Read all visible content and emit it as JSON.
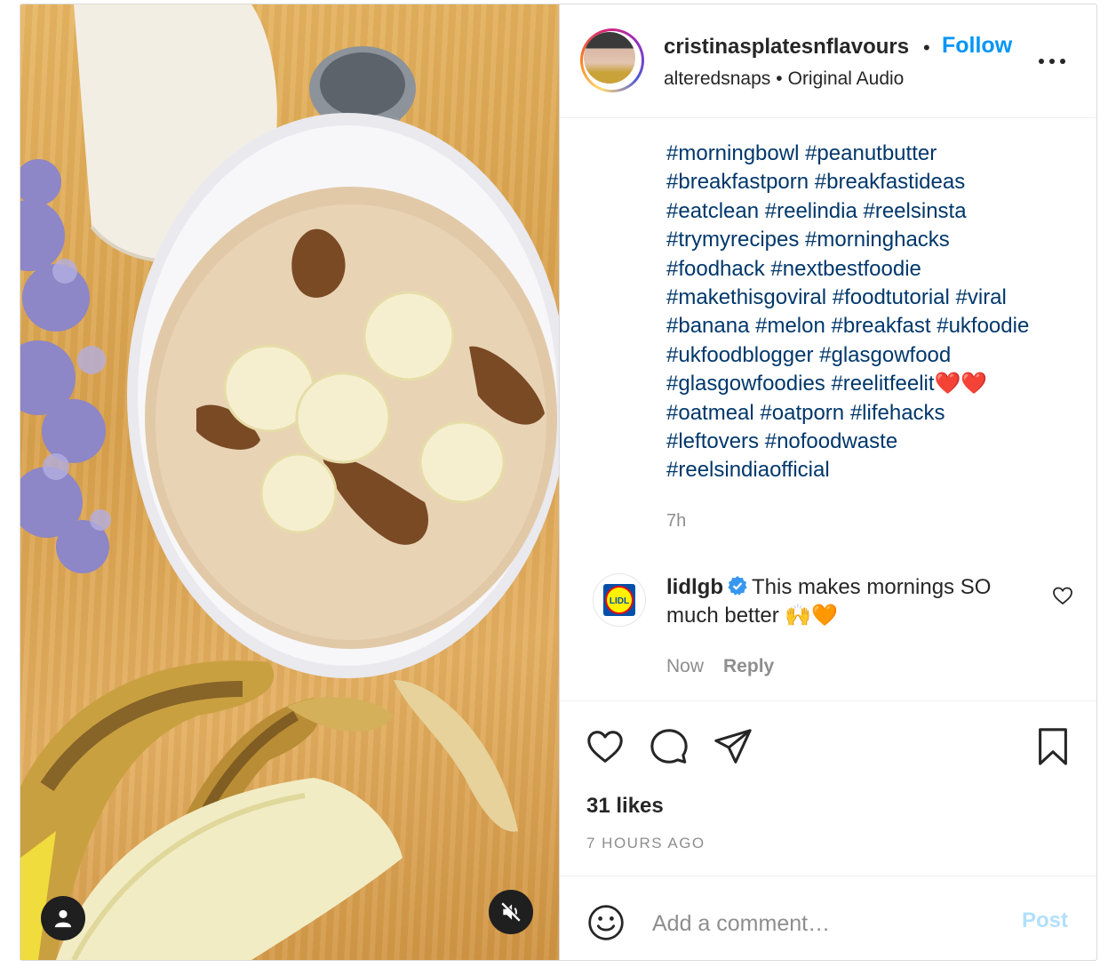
{
  "post": {
    "username": "cristinasplatesnflavours",
    "separator": "•",
    "follow_label": "Follow",
    "audio_user": "alteredsnaps",
    "audio_separator": "•",
    "audio_name": "Original Audio",
    "more_icon": "more-horizontal-icon"
  },
  "caption": {
    "lines": [
      "#morningbowl #peanutbutter",
      "#breakfastporn #breakfastideas",
      "#eatclean #reelindia #reelsinsta",
      "#trymyrecipes #morninghacks",
      "#foodhack #nextbestfoodie",
      "#makethisgoviral #foodtutorial #viral",
      "#banana #melon #breakfast #ukfoodie",
      "#ukfoodblogger #glasgowfood",
      "#glasgowfoodies #reelitfeelit❤️❤️",
      "#oatmeal #oatporn #lifehacks",
      "#leftovers #nofoodwaste",
      "#reelsindiaofficial"
    ],
    "time": "7h"
  },
  "comment": {
    "username": "lidlgb",
    "avatar_text": "LIDL",
    "text": "This makes mornings SO much better 🙌🧡",
    "time": "Now",
    "reply_label": "Reply"
  },
  "actions": {
    "icons": [
      "heart-icon",
      "comment-icon",
      "share-icon",
      "bookmark-icon"
    ],
    "likes": "31 likes",
    "time_ago": "7 HOURS AGO"
  },
  "add_comment": {
    "placeholder": "Add a comment…",
    "post_label": "Post"
  },
  "colors": {
    "link": "#00376b",
    "follow": "#0095f6",
    "post_disabled": "#b2dffc",
    "muted": "#8e8e8e"
  }
}
